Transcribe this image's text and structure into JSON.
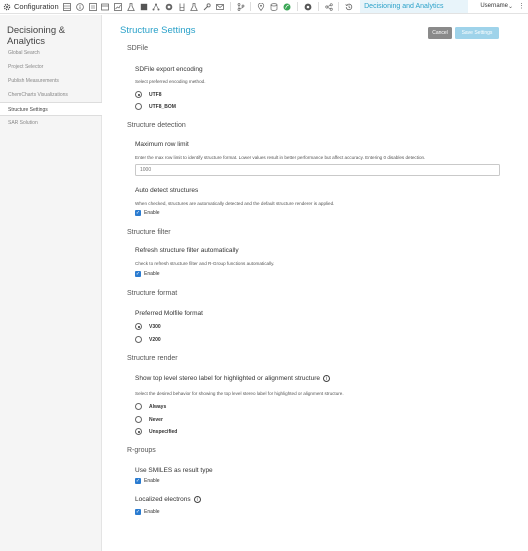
{
  "topbar": {
    "app_label": "Configuration",
    "active_tab": "Decisioning and Analytics",
    "username": "Username",
    "icons": [
      "grid-icon",
      "info-icon",
      "list-icon",
      "card-icon",
      "chart-icon",
      "flask-icon",
      "box-icon",
      "network-icon",
      "molecule-icon",
      "beaker-icon",
      "wrench-icon",
      "mail-icon",
      "branch-icon",
      "pin-icon",
      "database-icon",
      "leaf-icon",
      "atom-icon",
      "share-icon",
      "history-icon"
    ]
  },
  "sidebar": {
    "title": "Decisioning & Analytics",
    "items": [
      {
        "label": "Global Search"
      },
      {
        "label": "Project Selector"
      },
      {
        "label": "Publish Measurements"
      },
      {
        "label": "ChemCharts Visualizations"
      },
      {
        "label": "Structure Settings",
        "active": true
      },
      {
        "label": "SAR Solution"
      }
    ]
  },
  "main": {
    "title": "Structure Settings",
    "cancel_label": "Cancel",
    "save_label": "Save Settings",
    "sdfile": {
      "section": "SDFile",
      "field": "SDFile export encoding",
      "desc": "Select preferred encoding method.",
      "options": [
        "UTF8",
        "UTF8_BOM"
      ],
      "selected": "UTF8"
    },
    "detection": {
      "section": "Structure detection",
      "max_row": {
        "field": "Maximum row limit",
        "desc": "Enter the max row limit to identify structure format. Lower values result in better performance but affect accuracy. Entering 0 disables detection.",
        "placeholder": "1000"
      },
      "auto_detect": {
        "field": "Auto detect structures",
        "desc": "When checked, structures are automatically detected and the default structure renderer is applied.",
        "check_label": "Enable"
      }
    },
    "filter": {
      "section": "Structure filter",
      "field": "Refresh structure filter automatically",
      "desc": "Check to refresh structure filter and R-Group functions automatically.",
      "check_label": "Enable"
    },
    "format": {
      "section": "Structure format",
      "field": "Preferred Molfile format",
      "options": [
        "V300",
        "V200"
      ],
      "selected": "V300"
    },
    "render": {
      "section": "Structure render",
      "field": "Show top level stereo label for highlighted or alignment structure",
      "desc": "Select the desired behavior for showing the top level stereo label for highlighted or alignment structure.",
      "options": [
        "Always",
        "Never",
        "Unspecified"
      ],
      "selected": "Unspecified"
    },
    "rgroups": {
      "section": "R-groups",
      "smiles_field": "Use SMILES as result type",
      "smiles_check": "Enable",
      "electrons_field": "Localized electrons",
      "electrons_check": "Enable"
    }
  }
}
